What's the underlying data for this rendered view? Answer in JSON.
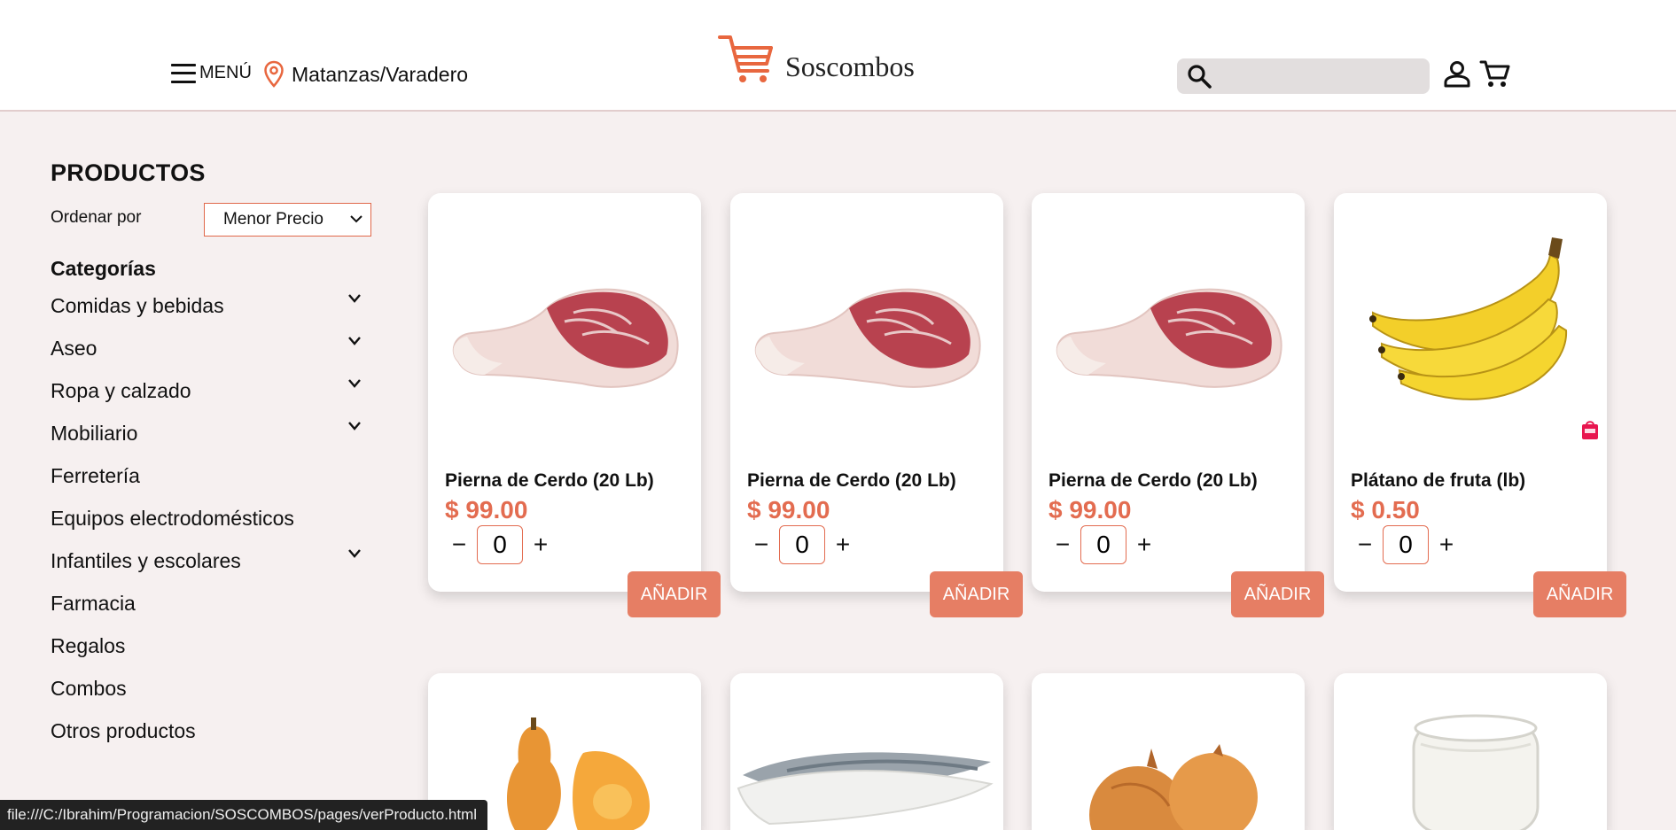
{
  "header": {
    "menu_label": "MENÚ",
    "location": "Matanzas/Varadero",
    "brand": "Soscombos",
    "search_placeholder": "",
    "accent": "#e8673f"
  },
  "sidebar": {
    "title": "PRODUCTOS",
    "sort_label": "Ordenar por",
    "sort_selected": "Menor Precio",
    "categories_title": "Categorías",
    "categories": [
      {
        "label": "Comidas y bebidas",
        "expandable": true
      },
      {
        "label": "Aseo",
        "expandable": true
      },
      {
        "label": "Ropa y calzado",
        "expandable": true
      },
      {
        "label": "Mobiliario",
        "expandable": true
      },
      {
        "label": "Ferretería",
        "expandable": false
      },
      {
        "label": "Equipos electrodomésticos",
        "expandable": false
      },
      {
        "label": "Infantiles y escolares",
        "expandable": true
      },
      {
        "label": "Farmacia",
        "expandable": false
      },
      {
        "label": "Regalos",
        "expandable": false
      },
      {
        "label": "Combos",
        "expandable": false
      },
      {
        "label": "Otros productos",
        "expandable": false
      }
    ]
  },
  "products": [
    {
      "name": "Pierna de Cerdo (20 Lb)",
      "price": "$ 99.00",
      "qty": "0",
      "add_label": "AÑADIR",
      "image": "pork-leg"
    },
    {
      "name": "Pierna de Cerdo (20 Lb)",
      "price": "$ 99.00",
      "qty": "0",
      "add_label": "AÑADIR",
      "image": "pork-leg"
    },
    {
      "name": "Pierna de Cerdo (20 Lb)",
      "price": "$ 99.00",
      "qty": "0",
      "add_label": "AÑADIR",
      "image": "pork-leg"
    },
    {
      "name": "Plátano de fruta (lb)",
      "price": "$ 0.50",
      "qty": "0",
      "add_label": "AÑADIR",
      "image": "banana"
    }
  ],
  "products_row2": [
    {
      "image": "squash"
    },
    {
      "image": "fish-fillet"
    },
    {
      "image": "onion"
    },
    {
      "image": "yogurt"
    }
  ],
  "qty_controls": {
    "minus": "−",
    "plus": "+"
  },
  "status_bar": "file:///C:/Ibrahim/Programacion/SOSCOMBOS/pages/verProducto.html"
}
